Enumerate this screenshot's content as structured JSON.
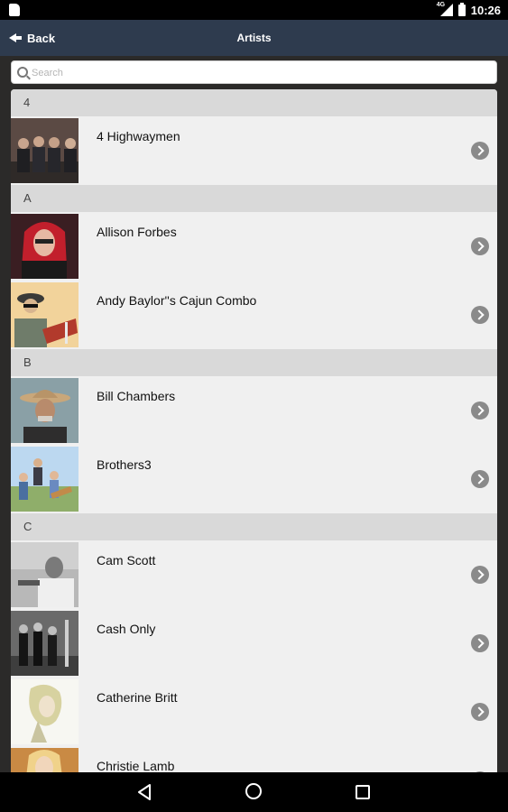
{
  "statusbar": {
    "time": "10:26",
    "network": "4G"
  },
  "appbar": {
    "back_label": "Back",
    "title": "Artists"
  },
  "search": {
    "placeholder": "Search"
  },
  "sections": [
    {
      "letter": "4",
      "artists": [
        {
          "name": "4 Highwaymen",
          "thumb_icon": "band-photo-icon"
        }
      ]
    },
    {
      "letter": "A",
      "artists": [
        {
          "name": "Allison Forbes",
          "thumb_icon": "artist-photo-icon"
        },
        {
          "name": "Andy Baylor''s Cajun Combo",
          "thumb_icon": "artist-photo-icon"
        }
      ]
    },
    {
      "letter": "B",
      "artists": [
        {
          "name": "Bill Chambers",
          "thumb_icon": "artist-photo-icon"
        },
        {
          "name": "Brothers3",
          "thumb_icon": "band-photo-icon"
        }
      ]
    },
    {
      "letter": "C",
      "artists": [
        {
          "name": "Cam Scott",
          "thumb_icon": "artist-photo-icon"
        },
        {
          "name": "Cash Only",
          "thumb_icon": "band-photo-icon"
        },
        {
          "name": "Catherine Britt",
          "thumb_icon": "artist-photo-icon"
        },
        {
          "name": "Christie Lamb",
          "thumb_icon": "artist-photo-icon"
        }
      ]
    }
  ],
  "colors": {
    "appbar": "#2e3b4e",
    "list_bg": "#f0f0f0",
    "section_bg": "#d9d9d9",
    "chevron": "#8a8a8a"
  }
}
